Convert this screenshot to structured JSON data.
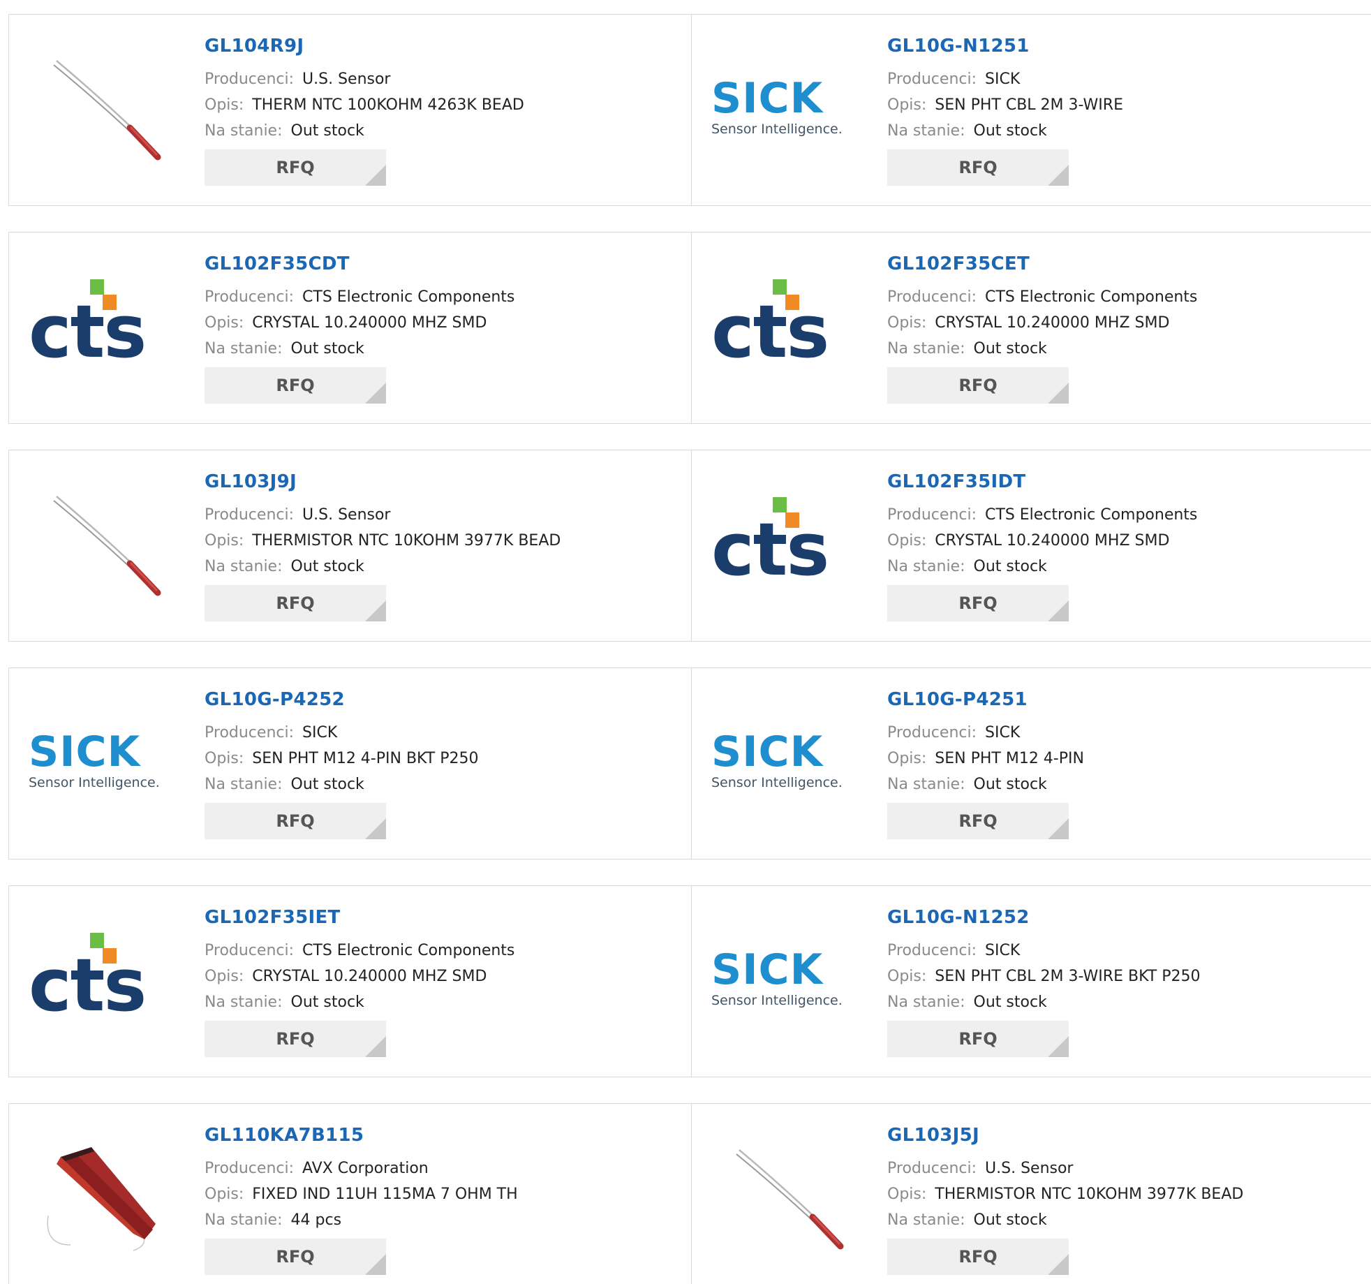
{
  "labels": {
    "manufacturer": "Producenci:",
    "description": "Opis:",
    "stock": "Na stanie:",
    "rfq": "RFQ"
  },
  "brand_colors": {
    "part_link": "#1a67b5",
    "sick_blue": "#1f8ece",
    "cts_navy": "#1a3d6b",
    "cts_green": "#6cbd45",
    "cts_orange": "#f08a24"
  },
  "logos": {
    "sick": {
      "word": "SICK",
      "tagline": "Sensor Intelligence."
    },
    "cts": {
      "word": "cts"
    }
  },
  "products": [
    {
      "part": "GL104R9J",
      "manufacturer": "U.S. Sensor",
      "description": "THERM NTC 100KOHM 4263K BEAD",
      "stock": "Out stock",
      "image": "thermistor-bead-image"
    },
    {
      "part": "GL10G-N1251",
      "manufacturer": "SICK",
      "description": "SEN PHT CBL 2M 3-WIRE",
      "stock": "Out stock",
      "image": "sick-logo"
    },
    {
      "part": "GL102F35CDT",
      "manufacturer": "CTS Electronic Components",
      "description": "CRYSTAL 10.240000 MHZ SMD",
      "stock": "Out stock",
      "image": "cts-logo"
    },
    {
      "part": "GL102F35CET",
      "manufacturer": "CTS Electronic Components",
      "description": "CRYSTAL 10.240000 MHZ SMD",
      "stock": "Out stock",
      "image": "cts-logo"
    },
    {
      "part": "GL103J9J",
      "manufacturer": "U.S. Sensor",
      "description": "THERMISTOR NTC 10KOHM 3977K BEAD",
      "stock": "Out stock",
      "image": "thermistor-bead-image"
    },
    {
      "part": "GL102F35IDT",
      "manufacturer": "CTS Electronic Components",
      "description": "CRYSTAL 10.240000 MHZ SMD",
      "stock": "Out stock",
      "image": "cts-logo"
    },
    {
      "part": "GL10G-P4252",
      "manufacturer": "SICK",
      "description": "SEN PHT M12 4-PIN BKT P250",
      "stock": "Out stock",
      "image": "sick-logo"
    },
    {
      "part": "GL10G-P4251",
      "manufacturer": "SICK",
      "description": "SEN PHT M12 4-PIN",
      "stock": "Out stock",
      "image": "sick-logo"
    },
    {
      "part": "GL102F35IET",
      "manufacturer": "CTS Electronic Components",
      "description": "CRYSTAL 10.240000 MHZ SMD",
      "stock": "Out stock",
      "image": "cts-logo"
    },
    {
      "part": "GL10G-N1252",
      "manufacturer": "SICK",
      "description": "SEN PHT CBL 2M 3-WIRE BKT P250",
      "stock": "Out stock",
      "image": "sick-logo"
    },
    {
      "part": "GL110KA7B115",
      "manufacturer": "AVX Corporation",
      "description": "FIXED IND 11UH 115MA 7 OHM TH",
      "stock": "44 pcs",
      "image": "inductor-image"
    },
    {
      "part": "GL103J5J",
      "manufacturer": "U.S. Sensor",
      "description": "THERMISTOR NTC 10KOHM 3977K BEAD",
      "stock": "Out stock",
      "image": "thermistor-bead-image"
    }
  ]
}
